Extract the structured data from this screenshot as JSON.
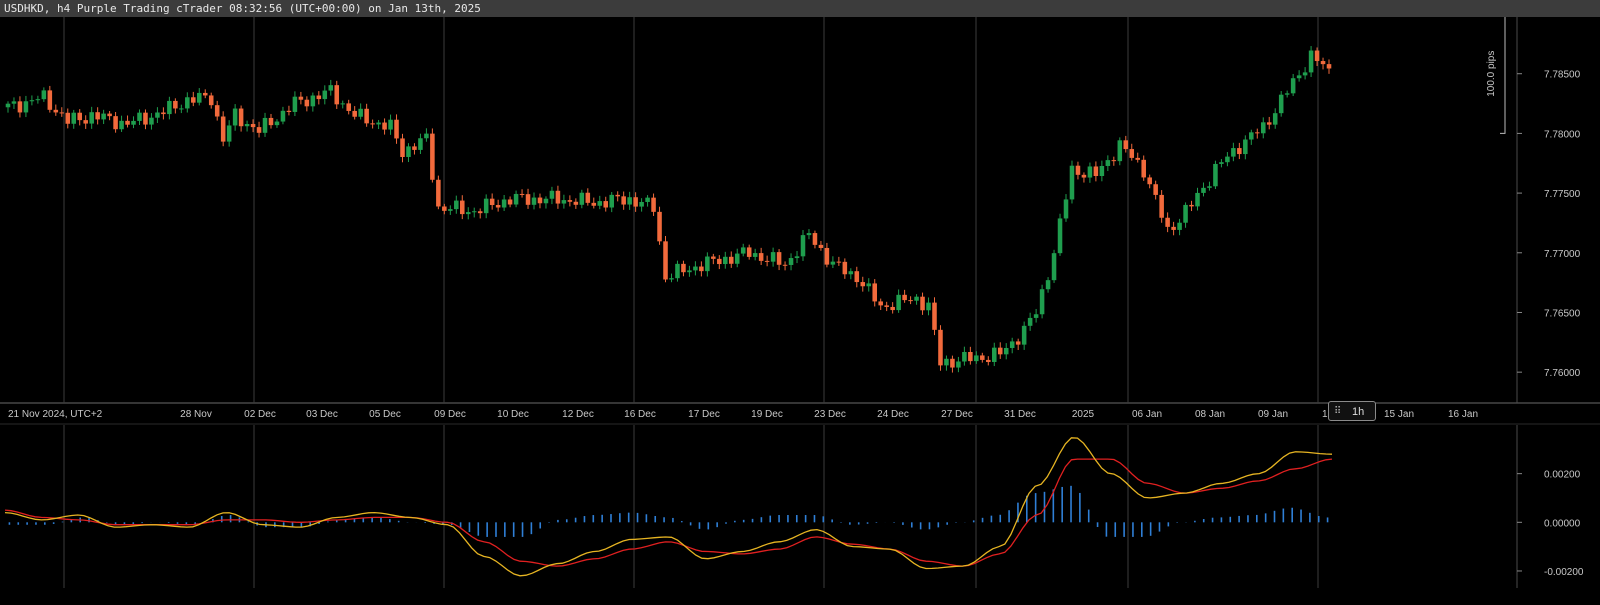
{
  "window": {
    "title": "USDHKD, h4 Purple Trading cTrader 08:32:56 (UTC+00:00) on Jan 13th, 2025"
  },
  "timeframe_badge": "1h",
  "colors": {
    "background": "#000000",
    "bull": "#1f9e4e",
    "bear": "#f26a3c",
    "macd_line": "#e6b422",
    "signal_line": "#e02020",
    "histogram": "#2f7fd6",
    "grid": "#3c3c3c",
    "text": "#c8c8c8"
  },
  "chart_data": [
    {
      "type": "candlestick",
      "symbol": "USDHKD",
      "timeframe": "h4",
      "ylim": [
        7.7575,
        7.7895
      ],
      "y_ticks": [
        "7.78500",
        "7.78000",
        "7.77500",
        "7.77000",
        "7.76500",
        "7.76000"
      ],
      "scale_label": "100.0 pips",
      "x_labels": [
        "21 Nov 2024, UTC+2",
        "28 Nov",
        "02 Dec",
        "03 Dec",
        "05 Dec",
        "09 Dec",
        "10 Dec",
        "12 Dec",
        "16 Dec",
        "17 Dec",
        "19 Dec",
        "23 Dec",
        "24 Dec",
        "27 Dec",
        "31 Dec",
        "2025",
        "06 Jan",
        "08 Jan",
        "09 Jan",
        "13 Jan",
        "15 Jan",
        "16 Jan"
      ],
      "close_anchors": [
        [
          0,
          7.7822
        ],
        [
          6,
          7.783
        ],
        [
          10,
          7.781
        ],
        [
          14,
          7.7815
        ],
        [
          20,
          7.7808
        ],
        [
          26,
          7.7818
        ],
        [
          30,
          7.7828
        ],
        [
          34,
          7.783
        ],
        [
          36,
          7.7795
        ],
        [
          38,
          7.7815
        ],
        [
          42,
          7.7802
        ],
        [
          48,
          7.7825
        ],
        [
          54,
          7.7835
        ],
        [
          58,
          7.7815
        ],
        [
          64,
          7.7805
        ],
        [
          66,
          7.7785
        ],
        [
          70,
          7.7795
        ],
        [
          72,
          7.7738
        ],
        [
          78,
          7.7735
        ],
        [
          84,
          7.7745
        ],
        [
          92,
          7.7745
        ],
        [
          98,
          7.7742
        ],
        [
          104,
          7.7745
        ],
        [
          108,
          7.7738
        ],
        [
          110,
          7.768
        ],
        [
          116,
          7.769
        ],
        [
          124,
          7.77
        ],
        [
          130,
          7.769
        ],
        [
          134,
          7.7715
        ],
        [
          138,
          7.769
        ],
        [
          142,
          7.768
        ],
        [
          146,
          7.7655
        ],
        [
          152,
          7.7662
        ],
        [
          154,
          7.7655
        ],
        [
          156,
          7.7608
        ],
        [
          162,
          7.7612
        ],
        [
          166,
          7.7615
        ],
        [
          170,
          7.7635
        ],
        [
          172,
          7.765
        ],
        [
          175,
          7.77
        ],
        [
          178,
          7.777
        ],
        [
          182,
          7.7765
        ],
        [
          186,
          7.779
        ],
        [
          190,
          7.777
        ],
        [
          194,
          7.7718
        ],
        [
          198,
          7.774
        ],
        [
          202,
          7.777
        ],
        [
          206,
          7.779
        ],
        [
          210,
          7.7805
        ],
        [
          214,
          7.7835
        ],
        [
          218,
          7.7865
        ],
        [
          221,
          7.7852
        ]
      ],
      "candle_count": 222,
      "vertical_separators": [
        "25 Nov",
        "02 Dec",
        "09 Dec",
        "16 Dec",
        "23 Dec",
        "30 Dec",
        "06 Jan",
        "13 Jan"
      ]
    },
    {
      "type": "line+histogram",
      "indicator": "MACD",
      "ylim": [
        -0.0027,
        0.004
      ],
      "y_ticks": [
        "0.00200",
        "0.00000",
        "-0.00200"
      ],
      "series": [
        {
          "role": "macd",
          "values": [
            0.0004,
            0.0001,
            0.0003,
            -0.0002,
            -0.0001,
            -0.0002,
            0.0004,
            -0.0001,
            -0.0002,
            0.0002,
            0.0004,
            0.0002,
            -0.0001,
            -0.0014,
            -0.0022,
            -0.0017,
            -0.0012,
            -0.0007,
            -0.0006,
            -0.0015,
            -0.0012,
            -0.0008,
            -0.0003,
            -0.001,
            -0.0011,
            -0.0019,
            -0.0018,
            -0.001,
            0.0015,
            0.0035,
            0.002,
            0.001,
            0.0012,
            0.0016,
            0.002,
            0.0029,
            0.0028
          ]
        },
        {
          "role": "signal",
          "values": [
            0.0005,
            0.0002,
            0.0001,
            -0.0001,
            -0.0001,
            -0.0001,
            0.0001,
            0.0001,
            0.0,
            0.0001,
            0.0002,
            0.0002,
            0.0,
            -0.0008,
            -0.0016,
            -0.0018,
            -0.0015,
            -0.0011,
            -0.0008,
            -0.0012,
            -0.0013,
            -0.0011,
            -0.0006,
            -0.0009,
            -0.0011,
            -0.0016,
            -0.0018,
            -0.0013,
            0.0003,
            0.0026,
            0.0026,
            0.0016,
            0.0012,
            0.0014,
            0.0017,
            0.0022,
            0.0026
          ]
        },
        {
          "role": "histogram",
          "values": [
            -0.0001,
            -0.0001,
            0.0002,
            -0.0001,
            0.0,
            -0.0001,
            0.0003,
            -0.0002,
            -0.0002,
            0.0001,
            0.0002,
            0.0,
            -0.0001,
            -0.0006,
            -0.0006,
            0.0001,
            0.0003,
            0.0004,
            0.0002,
            -0.0003,
            0.0001,
            0.0003,
            0.0003,
            -0.0001,
            0.0,
            -0.0003,
            0.0,
            0.0003,
            0.0012,
            0.0015,
            -0.0006,
            -0.0006,
            0.0,
            0.0002,
            0.0003,
            0.0006,
            0.0002
          ]
        }
      ]
    }
  ]
}
